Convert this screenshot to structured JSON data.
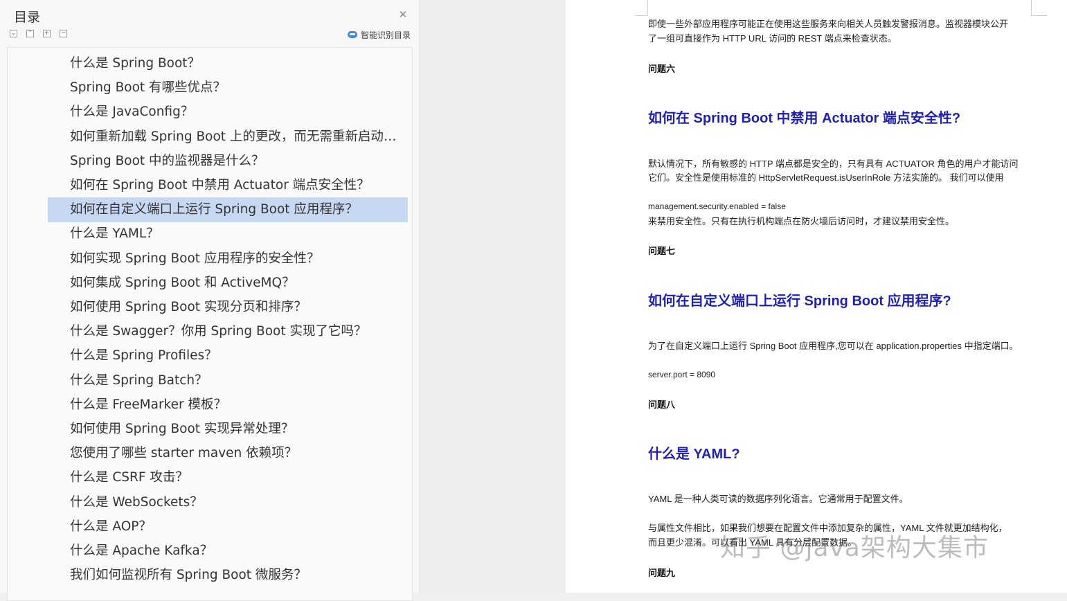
{
  "toc": {
    "title": "目录",
    "smart_label": "智能识别目录",
    "items": [
      {
        "label": "什么是 Spring Boot？",
        "selected": false
      },
      {
        "label": "Spring Boot 有哪些优点？",
        "selected": false
      },
      {
        "label": "什么是 JavaConfig？",
        "selected": false
      },
      {
        "label": "如何重新加载 Spring Boot 上的更改，而无需重新启动服务器？",
        "selected": false
      },
      {
        "label": "Spring Boot 中的监视器是什么？",
        "selected": false
      },
      {
        "label": "如何在 Spring Boot 中禁用 Actuator 端点安全性？",
        "selected": false
      },
      {
        "label": "如何在自定义端口上运行 Spring Boot 应用程序？",
        "selected": true
      },
      {
        "label": "什么是 YAML？",
        "selected": false
      },
      {
        "label": "如何实现 Spring Boot 应用程序的安全性？",
        "selected": false
      },
      {
        "label": "如何集成 Spring Boot 和 ActiveMQ？",
        "selected": false
      },
      {
        "label": "如何使用 Spring Boot 实现分页和排序？",
        "selected": false
      },
      {
        "label": "什么是 Swagger？你用 Spring Boot 实现了它吗？",
        "selected": false
      },
      {
        "label": "什么是 Spring Profiles？",
        "selected": false
      },
      {
        "label": "什么是 Spring Batch？",
        "selected": false
      },
      {
        "label": "什么是 FreeMarker 模板？",
        "selected": false
      },
      {
        "label": "如何使用 Spring Boot 实现异常处理？",
        "selected": false
      },
      {
        "label": "您使用了哪些 starter maven 依赖项？",
        "selected": false
      },
      {
        "label": "什么是 CSRF 攻击？",
        "selected": false
      },
      {
        "label": "什么是 WebSockets？",
        "selected": false
      },
      {
        "label": "什么是 AOP？",
        "selected": false
      },
      {
        "label": "什么是 Apache Kafka？",
        "selected": false
      },
      {
        "label": "我们如何监视所有 Spring Boot 微服务？",
        "selected": false
      }
    ]
  },
  "doc": {
    "p_intro_1": "即使一些外部应用程序可能正在使用这些服务来向相关人员触发警报消息。监视器模块公开",
    "p_intro_2": "了一组可直接作为 HTTP URL 访问的 REST 端点来检查状态。",
    "q6": "问题六",
    "h_actuator": "如何在 Spring Boot 中禁用 Actuator 端点安全性?",
    "p_actuator_1": "默认情况下，所有敏感的 HTTP 端点都是安全的，只有具有 ACTUATOR 角色的用户才能访问",
    "p_actuator_2": "它们。安全性是使用标准的 HttpServletRequest.isUserInRole 方法实施的。 我们可以使用",
    "code_security": "management.security.enabled = false",
    "p_actuator_3": "来禁用安全性。只有在执行机构端点在防火墙后访问时，才建议禁用安全性。",
    "q7": "问题七",
    "h_port": "如何在自定义端口上运行 Spring Boot 应用程序?",
    "p_port": "为了在自定义端口上运行 Spring Boot 应用程序,您可以在 application.properties 中指定端口。",
    "code_port": "server.port = 8090",
    "q8": "问题八",
    "h_yaml": "什么是 YAML?",
    "p_yaml_1": "YAML 是一种人类可读的数据序列化语言。它通常用于配置文件。",
    "p_yaml_2": "与属性文件相比，如果我们想要在配置文件中添加复杂的属性，YAML 文件就更加结构化，",
    "p_yaml_3": "而且更少混淆。可以看出 YAML 具有分层配置数据。",
    "q9": "问题九"
  },
  "watermark": "知乎 @java架构大集市"
}
